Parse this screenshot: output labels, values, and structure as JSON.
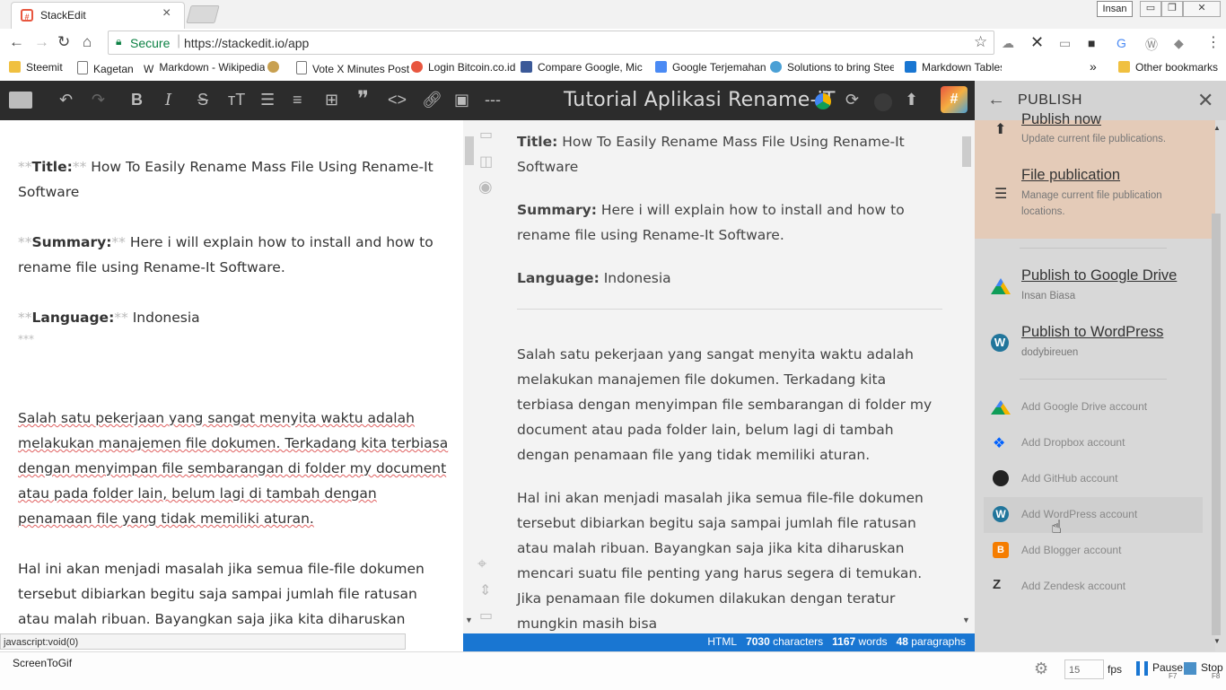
{
  "browser": {
    "tab_title": "StackEdit",
    "favicon": "#",
    "profile": "Insan",
    "window_controls": [
      "▭",
      "❐",
      "✕"
    ],
    "secure_label": "Secure",
    "url": "https://stackedit.io/app",
    "bookmarks": [
      {
        "label": "Steemit",
        "color": "#f0c040"
      },
      {
        "label": "Kagetan",
        "color": "#ffffff"
      },
      {
        "label": "Markdown - Wikipedia",
        "color": "#ffffff"
      },
      {
        "label": "",
        "color": "#c8a050"
      },
      {
        "label": "Vote X Minutes Post",
        "color": "#ffffff"
      },
      {
        "label": "Login Bitcoin.co.id",
        "color": "#e8563f"
      },
      {
        "label": "Compare Google, Micro",
        "color": "#3b5998"
      },
      {
        "label": "Google Terjemahan",
        "color": "#4a8af4"
      },
      {
        "label": "Solutions to bring Steem",
        "color": "#4aa0d5"
      },
      {
        "label": "Markdown Tables gener",
        "color": "#1976d2"
      }
    ],
    "more_bookmarks": "»",
    "other_bookmarks": "Other bookmarks"
  },
  "toolbar": {
    "document_title": "Tutorial Aplikasi Rename-iT",
    "hash_label": "#"
  },
  "editor": {
    "title_label": "Title:",
    "title_text": " How To Easily Rename Mass File Using Rename-It Software",
    "summary_label": "Summary:",
    "summary_text": " Here i will explain how to install and how to rename file using Rename-It Software.",
    "language_label": "Language:",
    "language_text": " Indonesia",
    "md_bold": "**",
    "md_rule": "***",
    "para1": "Salah satu pekerjaan yang sangat menyita waktu adalah melakukan manajemen file dokumen. Terkadang kita terbiasa dengan menyimpan file sembarangan di folder my document atau pada folder lain, belum lagi di tambah dengan penamaan file yang tidak memiliki aturan.",
    "para2": "Hal ini akan menjadi masalah jika semua file-file dokumen tersebut dibiarkan begitu saja sampai jumlah file ratusan atau malah ribuan. Bayangkan saja jika kita diharuskan mencari suatu"
  },
  "preview": {
    "title_label": "Title:",
    "title_text": " How To Easily Rename Mass File Using Rename-It Software",
    "summary_label": "Summary:",
    "summary_text": " Here i will explain how to install and how to rename file using Rename-It Software.",
    "language_label": "Language:",
    "language_text": " Indonesia",
    "para1": "Salah satu pekerjaan yang sangat menyita waktu adalah melakukan manajemen file dokumen. Terkadang kita terbiasa dengan menyimpan file sembarangan di folder my document atau pada folder lain, belum lagi di tambah dengan penamaan file yang tidak memiliki aturan.",
    "para2": "Hal ini akan menjadi masalah jika semua file-file dokumen tersebut dibiarkan begitu saja sampai jumlah file ratusan atau malah ribuan. Bayangkan saja jika kita diharuskan mencari suatu file penting yang harus segera di temukan. Jika penamaan file dokumen dilakukan dengan teratur mungkin masih bisa"
  },
  "statusbar": {
    "mode": "HTML",
    "characters_value": "7030",
    "characters_label": "characters",
    "words_value": "1167",
    "words_label": "words",
    "paragraphs_value": "48",
    "paragraphs_label": "paragraphs",
    "link_status": "javascript:void(0)"
  },
  "publish_panel": {
    "title": "PUBLISH",
    "publish_now_title": "Publish now",
    "publish_now_sub": "Update current file publications.",
    "file_publication_title": "File publication",
    "file_publication_sub": "Manage current file publication locations.",
    "targets": [
      {
        "title": "Publish to Google Drive",
        "sub": "Insan Biasa",
        "icon": "google-drive-icon"
      },
      {
        "title": "Publish to WordPress",
        "sub": "dodybireuen",
        "icon": "wordpress-icon"
      }
    ],
    "accounts": [
      {
        "label": "Add Google Drive account",
        "icon": "google-drive-icon",
        "color": "#f4b400"
      },
      {
        "label": "Add Dropbox account",
        "icon": "dropbox-icon",
        "color": "#0061ff"
      },
      {
        "label": "Add GitHub account",
        "icon": "github-icon",
        "color": "#222222"
      },
      {
        "label": "Add WordPress account",
        "icon": "wordpress-icon",
        "color": "#21759b"
      },
      {
        "label": "Add Blogger account",
        "icon": "blogger-icon",
        "color": "#f57d00"
      },
      {
        "label": "Add Zendesk account",
        "icon": "zendesk-icon",
        "color": "#333333"
      }
    ]
  },
  "screentogif": {
    "label": "ScreenToGif",
    "fps_value": "15",
    "fps_label": "fps",
    "pause_label": "Pause",
    "pause_key": "F7",
    "stop_label": "Stop",
    "stop_key": "F8"
  }
}
